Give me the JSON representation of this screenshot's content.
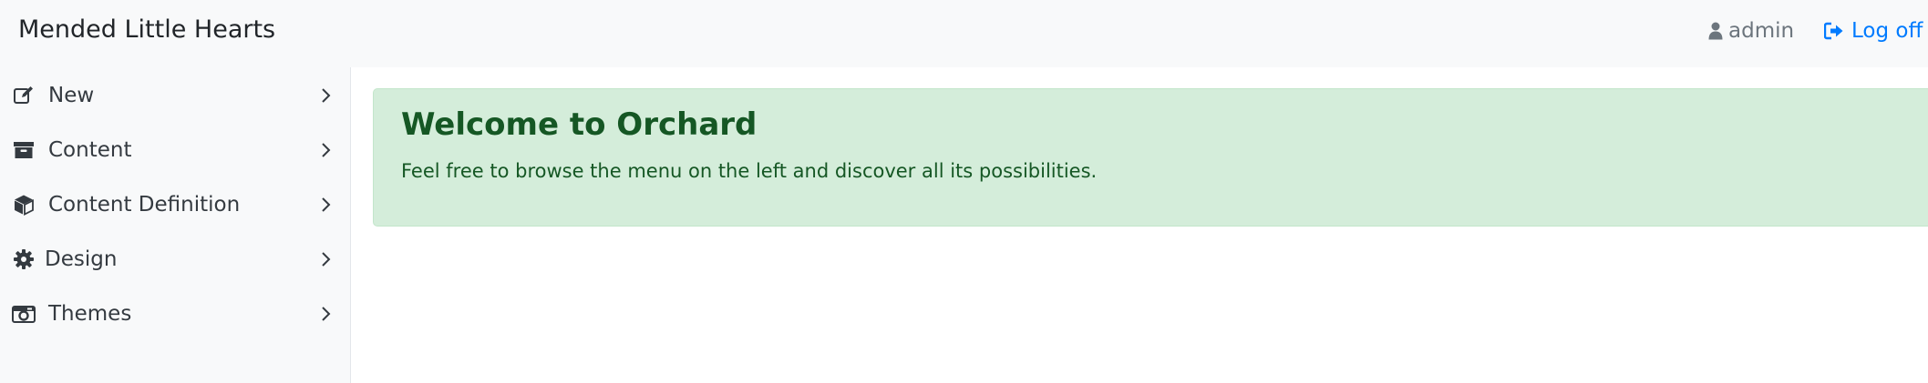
{
  "header": {
    "brand": "Mended Little Hearts",
    "user": {
      "name": "admin",
      "icon": "user-icon"
    },
    "logoff": {
      "label": "Log off",
      "icon": "sign-out-icon"
    }
  },
  "sidebar": {
    "items": [
      {
        "label": "New",
        "icon": "edit-icon"
      },
      {
        "label": "Content",
        "icon": "archive-icon"
      },
      {
        "label": "Content Definition",
        "icon": "cube-icon"
      },
      {
        "label": "Design",
        "icon": "gear-icon"
      },
      {
        "label": "Themes",
        "icon": "camera-icon"
      }
    ]
  },
  "main": {
    "alert": {
      "title": "Welcome to Orchard",
      "message": "Feel free to browse the menu on the left and discover all its possibilities."
    }
  },
  "colors": {
    "accent": "#007bff",
    "success_bg": "#d4edda",
    "success_text": "#155724",
    "sidebar_bg": "#f8f9fa"
  }
}
